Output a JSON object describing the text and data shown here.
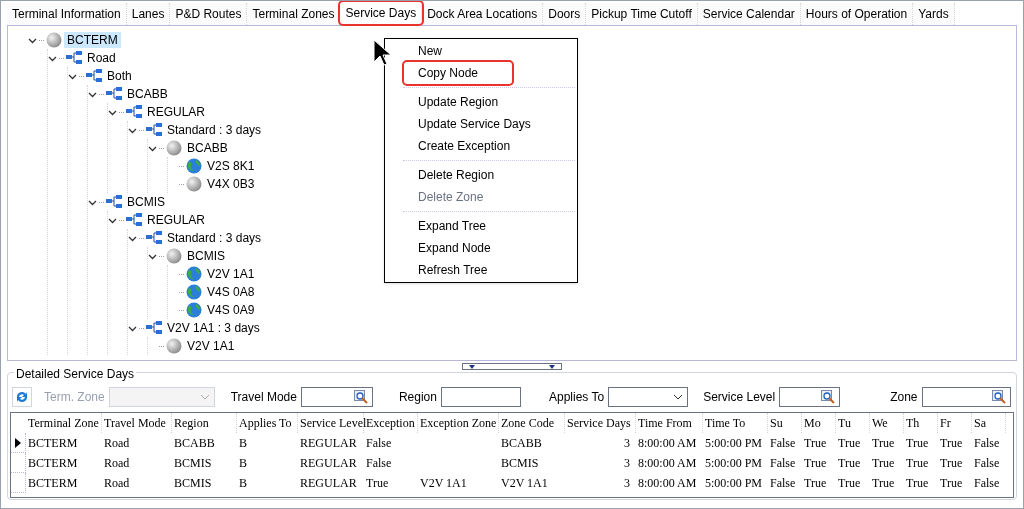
{
  "tabs": [
    {
      "label": "Terminal Information",
      "selected": false,
      "highlighted": false
    },
    {
      "label": "Lanes",
      "selected": false,
      "highlighted": false
    },
    {
      "label": "P&D Routes",
      "selected": false,
      "highlighted": false
    },
    {
      "label": "Terminal Zones",
      "selected": false,
      "highlighted": false
    },
    {
      "label": "Service Days",
      "selected": true,
      "highlighted": true
    },
    {
      "label": "Dock Area Locations",
      "selected": false,
      "highlighted": false
    },
    {
      "label": "Doors",
      "selected": false,
      "highlighted": false
    },
    {
      "label": "Pickup Time Cutoff",
      "selected": false,
      "highlighted": false
    },
    {
      "label": "Service Calendar",
      "selected": false,
      "highlighted": false
    },
    {
      "label": "Hours of Operation",
      "selected": false,
      "highlighted": false
    },
    {
      "label": "Yards",
      "selected": false,
      "highlighted": false
    }
  ],
  "tree": [
    {
      "label": "BCTERM",
      "kind": "sphere",
      "selected": true,
      "expanded": true,
      "children": [
        {
          "label": "Road",
          "kind": "network",
          "selected": false,
          "expanded": true,
          "children": [
            {
              "label": "Both",
              "kind": "network",
              "selected": false,
              "expanded": true,
              "children": [
                {
                  "label": "BCABB",
                  "kind": "network",
                  "selected": false,
                  "expanded": true,
                  "children": [
                    {
                      "label": "REGULAR",
                      "kind": "network",
                      "selected": false,
                      "expanded": true,
                      "children": [
                        {
                          "label": "Standard : 3 days",
                          "kind": "network",
                          "selected": false,
                          "expanded": true,
                          "children": [
                            {
                              "label": "BCABB",
                              "kind": "sphere",
                              "selected": false,
                              "expanded": true,
                              "children": [
                                {
                                  "label": "V2S 8K1",
                                  "kind": "globe",
                                  "selected": false
                                },
                                {
                                  "label": "V4X 0B3",
                                  "kind": "sphere",
                                  "selected": false
                                }
                              ]
                            }
                          ]
                        }
                      ]
                    }
                  ]
                },
                {
                  "label": "BCMIS",
                  "kind": "network",
                  "selected": false,
                  "expanded": true,
                  "children": [
                    {
                      "label": "REGULAR",
                      "kind": "network",
                      "selected": false,
                      "expanded": true,
                      "children": [
                        {
                          "label": "Standard : 3 days",
                          "kind": "network",
                          "selected": false,
                          "expanded": true,
                          "children": [
                            {
                              "label": "BCMIS",
                              "kind": "sphere",
                              "selected": false,
                              "expanded": true,
                              "children": [
                                {
                                  "label": "V2V 1A1",
                                  "kind": "globe",
                                  "selected": false
                                },
                                {
                                  "label": "V4S 0A8",
                                  "kind": "globe",
                                  "selected": false
                                },
                                {
                                  "label": "V4S 0A9",
                                  "kind": "globe",
                                  "selected": false
                                }
                              ]
                            }
                          ]
                        },
                        {
                          "label": "V2V 1A1 : 3 days",
                          "kind": "network",
                          "selected": false,
                          "expanded": true,
                          "children": [
                            {
                              "label": "V2V 1A1",
                              "kind": "sphere",
                              "selected": false
                            }
                          ]
                        }
                      ]
                    }
                  ]
                }
              ]
            }
          ]
        }
      ]
    }
  ],
  "context_menu": [
    {
      "label": "New",
      "kind": "item",
      "disabled": false,
      "highlighted": false
    },
    {
      "label": "Copy Node",
      "kind": "item",
      "disabled": false,
      "highlighted": true
    },
    {
      "kind": "separator"
    },
    {
      "label": "Update Region",
      "kind": "item",
      "disabled": false,
      "highlighted": false
    },
    {
      "label": "Update Service Days",
      "kind": "item",
      "disabled": false,
      "highlighted": false
    },
    {
      "label": "Create Exception",
      "kind": "item",
      "disabled": false,
      "highlighted": false
    },
    {
      "kind": "separator"
    },
    {
      "label": "Delete Region",
      "kind": "item",
      "disabled": false,
      "highlighted": false
    },
    {
      "label": "Delete Zone",
      "kind": "item",
      "disabled": true,
      "highlighted": false
    },
    {
      "kind": "separator"
    },
    {
      "label": "Expand Tree",
      "kind": "item",
      "disabled": false,
      "highlighted": false
    },
    {
      "label": "Expand Node",
      "kind": "item",
      "disabled": false,
      "highlighted": false
    },
    {
      "label": "Refresh Tree",
      "kind": "item",
      "disabled": false,
      "highlighted": false
    }
  ],
  "details": {
    "title": "Detailed Service Days",
    "filters": [
      {
        "label": "Term. Zone",
        "kind": "combo",
        "disabled": true
      },
      {
        "label": "Travel Mode",
        "kind": "lookup",
        "disabled": false
      },
      {
        "label": "Region",
        "kind": "text",
        "disabled": false
      },
      {
        "label": "Applies To",
        "kind": "combo",
        "disabled": false
      },
      {
        "label": "Service Level",
        "kind": "lookup",
        "disabled": false
      },
      {
        "label": "Zone",
        "kind": "lookup",
        "disabled": false
      }
    ],
    "table": {
      "columns": [
        "Terminal Zone",
        "Travel Mode",
        "Region",
        "Applies To",
        "Service Level",
        "Exception",
        "Exception Zone",
        "Zone Code",
        "Service Days",
        "Time From",
        "Time To",
        "Su",
        "Mo",
        "Tu",
        "We",
        "Th",
        "Fr",
        "Sa"
      ],
      "rows": [
        {
          "current": true,
          "cells": [
            "BCTERM",
            "Road",
            "BCABB",
            "B",
            "REGULAR",
            "False",
            "",
            "BCABB",
            "3",
            "8:00:00 AM",
            "5:00:00 PM",
            "False",
            "True",
            "True",
            "True",
            "True",
            "True",
            "False"
          ]
        },
        {
          "current": false,
          "cells": [
            "BCTERM",
            "Road",
            "BCMIS",
            "B",
            "REGULAR",
            "False",
            "",
            "BCMIS",
            "3",
            "8:00:00 AM",
            "5:00:00 PM",
            "False",
            "True",
            "True",
            "True",
            "True",
            "True",
            "False"
          ]
        },
        {
          "current": false,
          "cells": [
            "BCTERM",
            "Road",
            "BCMIS",
            "B",
            "REGULAR",
            "True",
            "V2V 1A1",
            "V2V 1A1",
            "3",
            "8:00:00 AM",
            "5:00:00 PM",
            "False",
            "True",
            "True",
            "True",
            "True",
            "True",
            "False"
          ]
        }
      ]
    }
  }
}
